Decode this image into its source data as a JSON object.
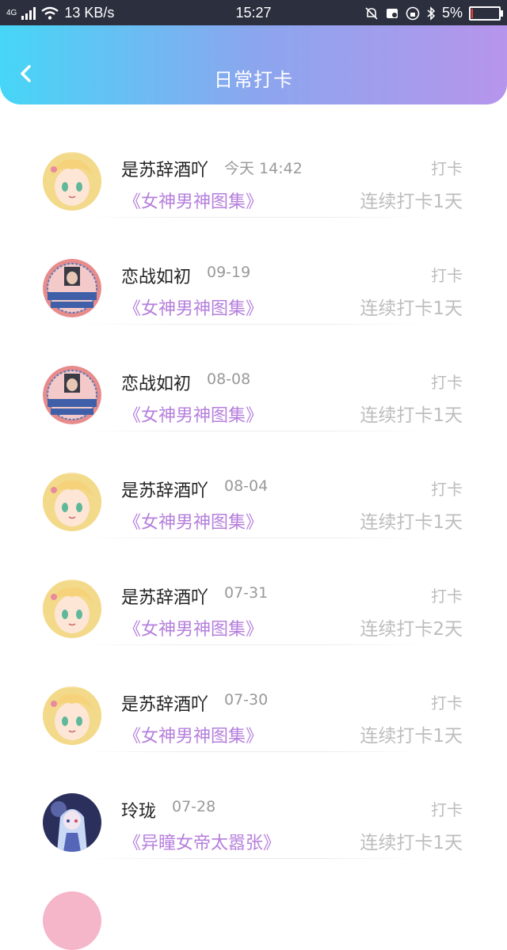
{
  "status_bar": {
    "network": "4G",
    "speed": "13 KB/s",
    "time": "15:27",
    "battery": "5%",
    "battery_level": 0.05
  },
  "header": {
    "title": "日常打卡",
    "back_icon": "chevron-left-icon"
  },
  "checkins": [
    {
      "name": "是苏辞酒吖",
      "date": "今天 14:42",
      "album": "《女神男神图集》",
      "badge": "打卡",
      "streak": "连续打卡1天",
      "avatar": "anime-girl"
    },
    {
      "name": "恋战如初",
      "date": "09-19",
      "album": "《女神男神图集》",
      "badge": "打卡",
      "streak": "连续打卡1天",
      "avatar": "birthday-photo"
    },
    {
      "name": "恋战如初",
      "date": "08-08",
      "album": "《女神男神图集》",
      "badge": "打卡",
      "streak": "连续打卡1天",
      "avatar": "birthday-photo"
    },
    {
      "name": "是苏辞酒吖",
      "date": "08-04",
      "album": "《女神男神图集》",
      "badge": "打卡",
      "streak": "连续打卡1天",
      "avatar": "anime-girl"
    },
    {
      "name": "是苏辞酒吖",
      "date": "07-31",
      "album": "《女神男神图集》",
      "badge": "打卡",
      "streak": "连续打卡2天",
      "avatar": "anime-girl"
    },
    {
      "name": "是苏辞酒吖",
      "date": "07-30",
      "album": "《女神男神图集》",
      "badge": "打卡",
      "streak": "连续打卡1天",
      "avatar": "anime-girl"
    },
    {
      "name": "玲珑",
      "date": "07-28",
      "album": "《异瞳女帝太嚣张》",
      "badge": "打卡",
      "streak": "连续打卡1天",
      "avatar": "anime-blue"
    }
  ],
  "colors": {
    "header_gradient": [
      "#46d6f6",
      "#8ba6ee",
      "#b695ec"
    ],
    "album_text": "#b67fdc",
    "muted_text": "#bdbdbd"
  }
}
